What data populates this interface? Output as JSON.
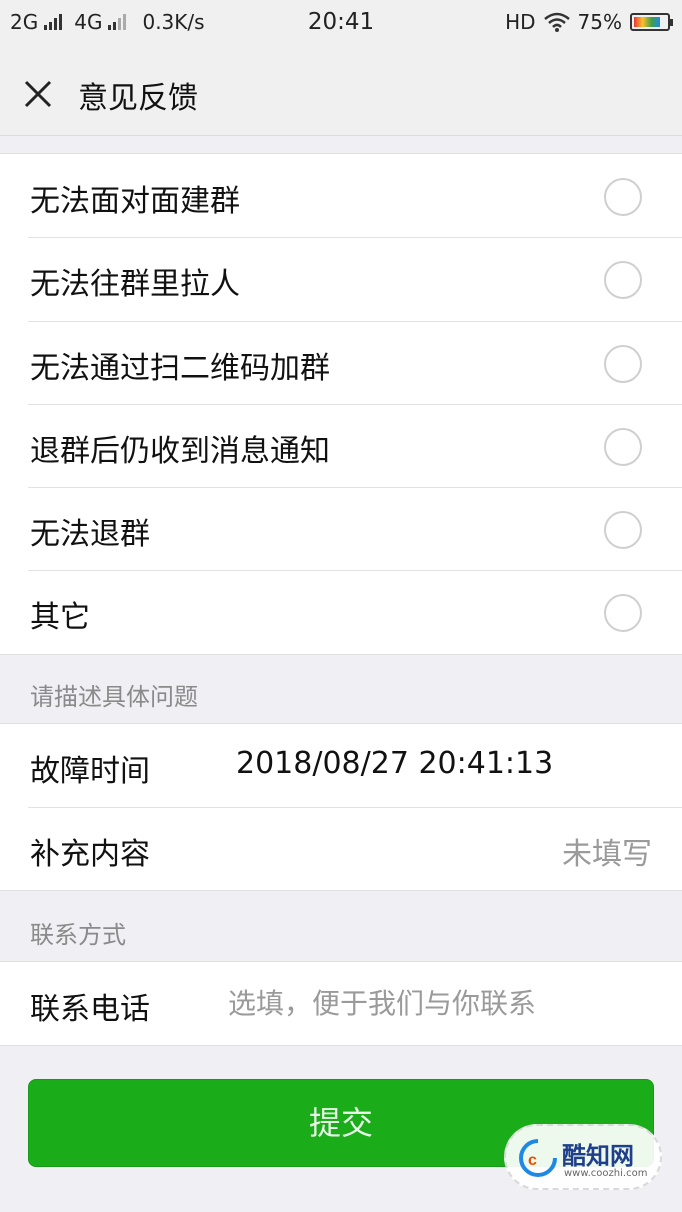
{
  "status_bar": {
    "network_1": "2G",
    "network_2": "4G",
    "speed": "0.3K/s",
    "time": "20:41",
    "hd": "HD",
    "battery": "75%",
    "battery_level": 0.75
  },
  "header": {
    "title": "意见反馈",
    "close_icon": "close-icon"
  },
  "options": [
    {
      "label": "无法面对面建群",
      "selected": false
    },
    {
      "label": "无法往群里拉人",
      "selected": false
    },
    {
      "label": "无法通过扫二维码加群",
      "selected": false
    },
    {
      "label": "退群后仍收到消息通知",
      "selected": false
    },
    {
      "label": "无法退群",
      "selected": false
    },
    {
      "label": "其它",
      "selected": false
    }
  ],
  "detail_section": {
    "title": "请描述具体问题",
    "fault_time_label": "故障时间",
    "fault_time_value": "2018/08/27 20:41:13",
    "extra_label": "补充内容",
    "extra_value": "未填写"
  },
  "contact_section": {
    "title": "联系方式",
    "phone_label": "联系电话",
    "phone_placeholder": "选填，便于我们与你联系",
    "phone_value": ""
  },
  "submit_label": "提交",
  "watermark": {
    "name": "酷知网",
    "url": "www.coozhi.com"
  },
  "colors": {
    "accent": "#1aad19",
    "background": "#efeff4",
    "radio_border": "#cfcfcf"
  }
}
